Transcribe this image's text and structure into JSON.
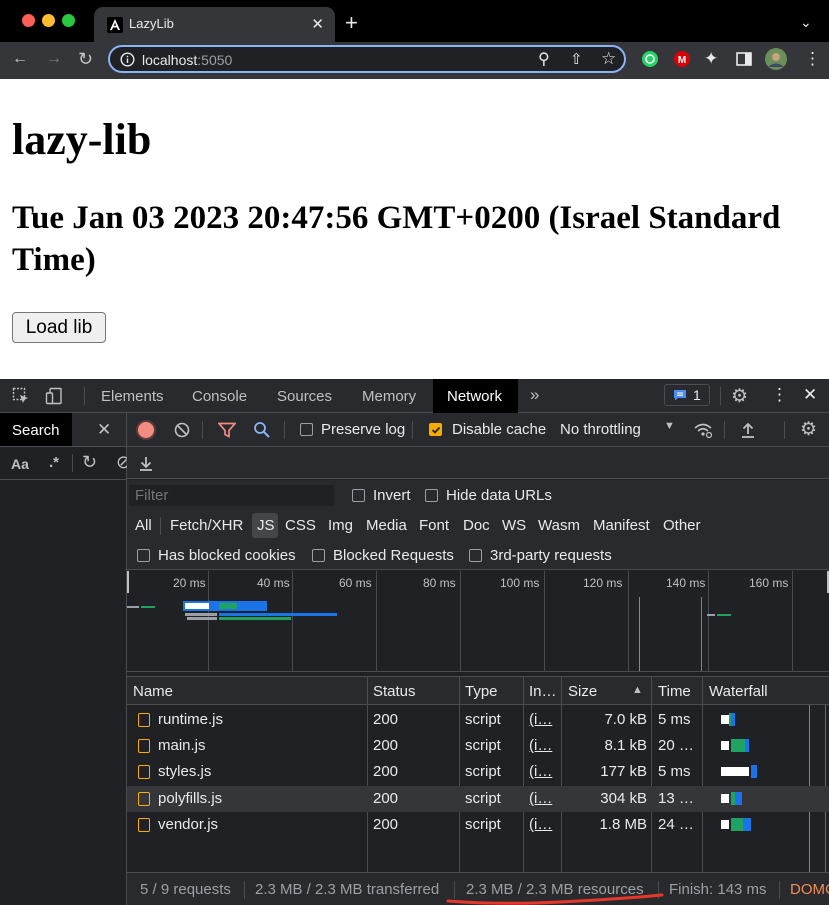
{
  "browser": {
    "tab_title": "LazyLib",
    "tab_close": "✕",
    "new_tab": "+",
    "url_host": "localhost",
    "url_port": ":5050"
  },
  "page": {
    "heading": "lazy-lib",
    "date_text": "Tue Jan 03 2023 20:47:56 GMT+0200 (Israel Standard Time)",
    "load_button": "Load lib"
  },
  "devtools": {
    "tabs": [
      "Elements",
      "Console",
      "Sources",
      "Memory",
      "Network"
    ],
    "active_tab": "Network",
    "more_tabs": "»",
    "issues_count": "1",
    "search_label": "Search",
    "search_case": "Aa",
    "search_regex": ".*",
    "network": {
      "preserve_log": "Preserve log",
      "disable_cache": "Disable cache",
      "disable_cache_checked": true,
      "throttling": "No throttling",
      "filter_placeholder": "Filter",
      "invert": "Invert",
      "hide_data_urls": "Hide data URLs",
      "type_filters": [
        "All",
        "Fetch/XHR",
        "JS",
        "CSS",
        "Img",
        "Media",
        "Font",
        "Doc",
        "WS",
        "Wasm",
        "Manifest",
        "Other"
      ],
      "active_type_filter": "JS",
      "has_blocked_cookies": "Has blocked cookies",
      "blocked_requests": "Blocked Requests",
      "third_party": "3rd-party requests",
      "overview_ticks": [
        "20 ms",
        "40 ms",
        "60 ms",
        "80 ms",
        "100 ms",
        "120 ms",
        "140 ms",
        "160 ms"
      ],
      "columns": [
        "Name",
        "Status",
        "Type",
        "In…",
        "Size",
        "Time",
        "Waterfall"
      ],
      "rows": [
        {
          "name": "runtime.js",
          "status": "200",
          "type": "script",
          "initiator": "(i…",
          "size": "7.0 kB",
          "time": "5 ms"
        },
        {
          "name": "main.js",
          "status": "200",
          "type": "script",
          "initiator": "(i…",
          "size": "8.1 kB",
          "time": "20 …"
        },
        {
          "name": "styles.js",
          "status": "200",
          "type": "script",
          "initiator": "(i…",
          "size": "177 kB",
          "time": "5 ms"
        },
        {
          "name": "polyfills.js",
          "status": "200",
          "type": "script",
          "initiator": "(i…",
          "size": "304 kB",
          "time": "13 …"
        },
        {
          "name": "vendor.js",
          "status": "200",
          "type": "script",
          "initiator": "(i…",
          "size": "1.8 MB",
          "time": "24 …"
        }
      ],
      "status": {
        "requests": "5 / 9 requests",
        "transferred": "2.3 MB / 2.3 MB transferred",
        "resources": "2.3 MB / 2.3 MB resources",
        "finish": "Finish: 143 ms",
        "dom": "DOMC"
      }
    }
  },
  "colors": {
    "accent": "#8ab4f8",
    "annotation": "#e8372a",
    "js_icon": "#f9ab00"
  }
}
